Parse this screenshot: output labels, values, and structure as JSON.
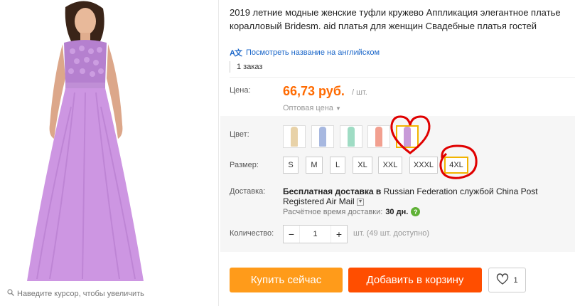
{
  "product": {
    "title": "2019 летние модные женские туфли кружево Аппликация элегантное платье коралловый Bridesm. aid платья для женщин Свадебные платья гостей",
    "translate_link": "Посмотреть название на английском",
    "orders": "1 заказ",
    "zoom_hint": "Наведите курсор, чтобы увеличить"
  },
  "price": {
    "label": "Цена:",
    "value": "66,73 руб.",
    "unit": "/ шт.",
    "wholesale": "Оптовая цена"
  },
  "color": {
    "label": "Цвет:",
    "selected_index": 4,
    "swatches": [
      {
        "name": "champagne",
        "color": "#e8d2a8"
      },
      {
        "name": "blue",
        "color": "#a7b8e0"
      },
      {
        "name": "mint",
        "color": "#9fdcc4"
      },
      {
        "name": "coral",
        "color": "#f2a090"
      },
      {
        "name": "lavender",
        "color": "#c89ad8"
      }
    ]
  },
  "size": {
    "label": "Размер:",
    "options": [
      "S",
      "M",
      "L",
      "XL",
      "XXL",
      "XXXL",
      "4XL"
    ],
    "selected": "4XL"
  },
  "shipping": {
    "label": "Доставка:",
    "free": "Бесплатная доставка в",
    "destination": "Russian Federation",
    "via": "службой",
    "method": "China Post Registered Air Mail",
    "time_label": "Расчётное время доставки:",
    "time_value": "30 дн."
  },
  "quantity": {
    "label": "Количество:",
    "value": "1",
    "available": "шт. (49 шт. доступно)"
  },
  "actions": {
    "buy_now": "Купить сейчас",
    "add_to_cart": "Добавить в корзину",
    "wishlist_count": "1"
  },
  "colors": {
    "accent_orange": "#ff6a00",
    "buy_button": "#ff9b1a",
    "cart_button": "#ff4e00",
    "selected_border": "#f2b400",
    "annotation_red": "#e00000",
    "link_blue": "#1a66c9"
  }
}
